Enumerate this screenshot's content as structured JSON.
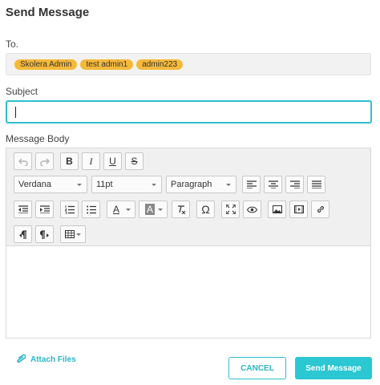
{
  "dialog": {
    "title": "Send Message"
  },
  "to": {
    "label": "To.",
    "recipients": [
      "Skolera Admin",
      "test admin1",
      "admin223"
    ]
  },
  "subject": {
    "label": "Subject",
    "value": ""
  },
  "body": {
    "label": "Message Body",
    "toolbar": {
      "font_family": "Verdana",
      "font_size": "11pt",
      "block_format": "Paragraph",
      "text_color_glyph": "A",
      "bg_color_glyph": "A",
      "bold_glyph": "B",
      "italic_glyph": "I",
      "underline_glyph": "U",
      "strike_glyph": "S",
      "special_char_glyph": "Ω"
    },
    "content": ""
  },
  "footer": {
    "attach_label": "Attach Files",
    "cancel_label": "CANCEL",
    "send_label": "Send Message"
  },
  "colors": {
    "accent": "#2bc0cf",
    "chip": "#f5b93a"
  }
}
